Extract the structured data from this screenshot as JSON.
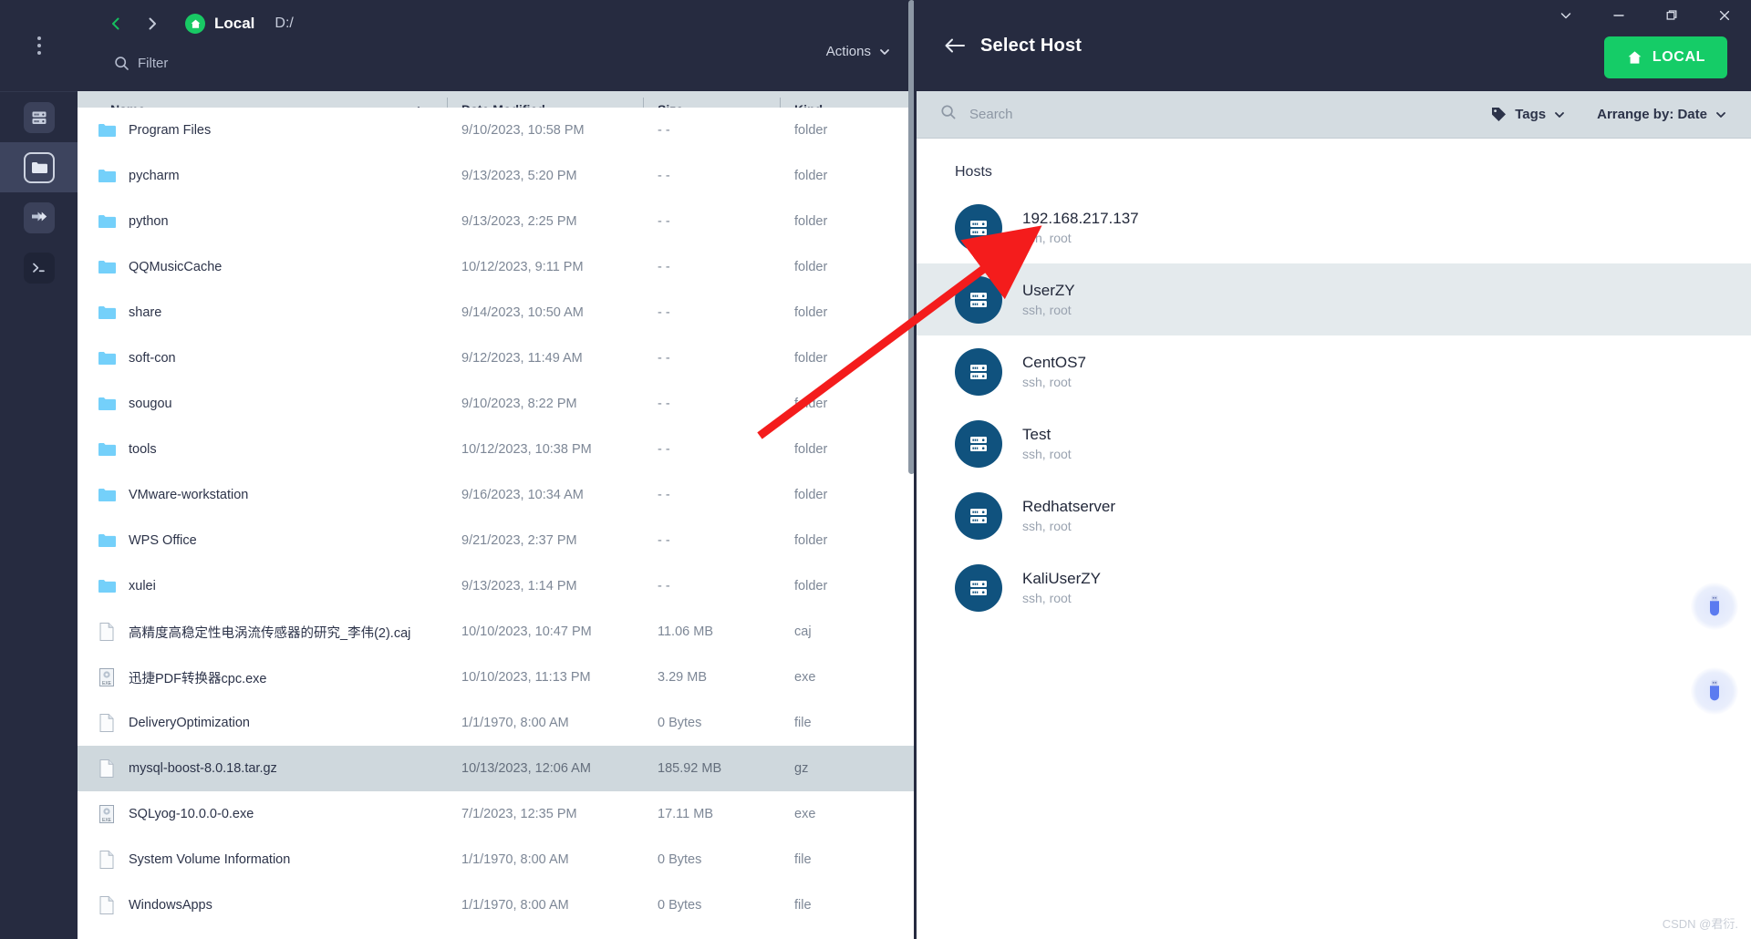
{
  "rail": {
    "menu_icon": "kebab-menu-icon",
    "items": [
      {
        "icon": "server-icon",
        "name": "rail-item-servers",
        "active": false
      },
      {
        "icon": "folder-icon",
        "name": "rail-item-files",
        "active": true
      },
      {
        "icon": "transfer-icon",
        "name": "rail-item-transfers",
        "active": false
      },
      {
        "icon": "terminal-icon",
        "name": "rail-item-terminal",
        "active": false
      }
    ]
  },
  "files": {
    "back_icon": "chevron-left-icon",
    "forward_icon": "chevron-right-icon",
    "home_icon": "home-icon",
    "location_label": "Local",
    "path": "D:/",
    "filter_placeholder": "Filter",
    "search_icon": "search-icon",
    "actions_label": "Actions",
    "actions_caret": "chevron-down-icon",
    "columns": [
      "Name",
      "Date Modified",
      "Size",
      "Kind"
    ],
    "sort_column": "Name",
    "sort_caret": "chevron-up-icon",
    "rows": [
      {
        "name": "Program Files",
        "date": "9/10/2023, 10:58 PM",
        "size": "- -",
        "kind": "folder",
        "icon": "folder-icon",
        "selected": false
      },
      {
        "name": "pycharm",
        "date": "9/13/2023, 5:20 PM",
        "size": "- -",
        "kind": "folder",
        "icon": "folder-icon",
        "selected": false
      },
      {
        "name": "python",
        "date": "9/13/2023, 2:25 PM",
        "size": "- -",
        "kind": "folder",
        "icon": "folder-icon",
        "selected": false
      },
      {
        "name": "QQMusicCache",
        "date": "10/12/2023, 9:11 PM",
        "size": "- -",
        "kind": "folder",
        "icon": "folder-icon",
        "selected": false
      },
      {
        "name": "share",
        "date": "9/14/2023, 10:50 AM",
        "size": "- -",
        "kind": "folder",
        "icon": "folder-icon",
        "selected": false
      },
      {
        "name": "soft-con",
        "date": "9/12/2023, 11:49 AM",
        "size": "- -",
        "kind": "folder",
        "icon": "folder-icon",
        "selected": false
      },
      {
        "name": "sougou",
        "date": "9/10/2023, 8:22 PM",
        "size": "- -",
        "kind": "folder",
        "icon": "folder-icon",
        "selected": false
      },
      {
        "name": "tools",
        "date": "10/12/2023, 10:38 PM",
        "size": "- -",
        "kind": "folder",
        "icon": "folder-icon",
        "selected": false
      },
      {
        "name": "VMware-workstation",
        "date": "9/16/2023, 10:34 AM",
        "size": "- -",
        "kind": "folder",
        "icon": "folder-icon",
        "selected": false
      },
      {
        "name": "WPS Office",
        "date": "9/21/2023, 2:37 PM",
        "size": "- -",
        "kind": "folder",
        "icon": "folder-icon",
        "selected": false
      },
      {
        "name": "xulei",
        "date": "9/13/2023, 1:14 PM",
        "size": "- -",
        "kind": "folder",
        "icon": "folder-icon",
        "selected": false
      },
      {
        "name": "高精度高稳定性电涡流传感器的研究_李伟(2).caj",
        "date": "10/10/2023, 10:47 PM",
        "size": "11.06 MB",
        "kind": "caj",
        "icon": "file-icon",
        "selected": false
      },
      {
        "name": "迅捷PDF转换器cpc.exe",
        "date": "10/10/2023, 11:13 PM",
        "size": "3.29 MB",
        "kind": "exe",
        "icon": "exe-icon",
        "selected": false
      },
      {
        "name": "DeliveryOptimization",
        "date": "1/1/1970, 8:00 AM",
        "size": "0 Bytes",
        "kind": "file",
        "icon": "file-icon",
        "selected": false
      },
      {
        "name": "mysql-boost-8.0.18.tar.gz",
        "date": "10/13/2023, 12:06 AM",
        "size": "185.92 MB",
        "kind": "gz",
        "icon": "file-icon",
        "selected": true
      },
      {
        "name": "SQLyog-10.0.0-0.exe",
        "date": "7/1/2023, 12:35 PM",
        "size": "17.11 MB",
        "kind": "exe",
        "icon": "exe-icon",
        "selected": false
      },
      {
        "name": "System Volume Information",
        "date": "1/1/1970, 8:00 AM",
        "size": "0 Bytes",
        "kind": "file",
        "icon": "file-icon",
        "selected": false
      },
      {
        "name": "WindowsApps",
        "date": "1/1/1970, 8:00 AM",
        "size": "0 Bytes",
        "kind": "file",
        "icon": "file-icon",
        "selected": false
      }
    ]
  },
  "host_panel": {
    "back_icon": "arrow-left-icon",
    "title": "Select Host",
    "local_button_label": "LOCAL",
    "local_button_icon": "home-icon",
    "local_button_color": "#15cc67",
    "window_controls": [
      {
        "name": "window-collapse-button",
        "icon": "chevron-down-icon"
      },
      {
        "name": "window-minimize-button",
        "icon": "minimize-icon"
      },
      {
        "name": "window-maximize-button",
        "icon": "maximize-icon"
      },
      {
        "name": "window-close-button",
        "icon": "close-icon"
      }
    ],
    "search_placeholder": "Search",
    "search_value": "",
    "search_icon": "search-icon",
    "tags_label": "Tags",
    "tags_icon": "tag-icon",
    "tags_caret": "chevron-down-icon",
    "arrange_label": "Arrange by: Date",
    "arrange_caret": "chevron-down-icon",
    "hosts_heading": "Hosts",
    "hosts": [
      {
        "name": "192.168.217.137",
        "sub": "ssh, root",
        "icon": "server-icon",
        "selected": false
      },
      {
        "name": "UserZY",
        "sub": "ssh, root",
        "icon": "server-icon",
        "selected": true
      },
      {
        "name": "CentOS7",
        "sub": "ssh, root",
        "icon": "server-icon",
        "selected": false
      },
      {
        "name": "Test",
        "sub": "ssh, root",
        "icon": "server-icon",
        "selected": false
      },
      {
        "name": "Redhatserver",
        "sub": "ssh, root",
        "icon": "server-icon",
        "selected": false
      },
      {
        "name": "KaliUserZY",
        "sub": "ssh, root",
        "icon": "server-icon",
        "selected": false
      }
    ],
    "usb_devices": [
      {
        "name": "usb-device-1",
        "icon": "usb-icon"
      },
      {
        "name": "usb-device-2",
        "icon": "usb-icon"
      }
    ]
  },
  "annotation": {
    "arrow_color": "#f41c1c",
    "target": "192.168.217.137"
  },
  "watermark": "CSDN @君衍."
}
